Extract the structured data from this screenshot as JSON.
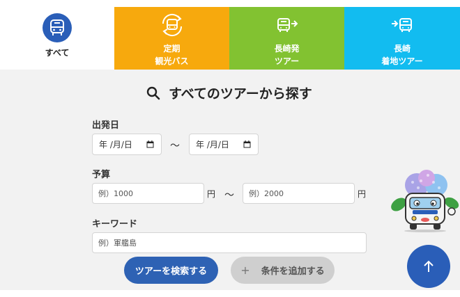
{
  "tabs": [
    {
      "label": "すべて",
      "icon": "bus-front-icon",
      "color": "#2a5eb8"
    },
    {
      "label_line1": "定期",
      "label_line2": "観光バス",
      "icon": "bus-loop-icon",
      "color": "#f7a90d"
    },
    {
      "label_line1": "長崎発",
      "label_line2": "ツアー",
      "icon": "bus-depart-icon",
      "color": "#82c231"
    },
    {
      "label_line1": "長崎",
      "label_line2": "着地ツアー",
      "icon": "bus-arrive-icon",
      "color": "#12bcf0"
    }
  ],
  "search": {
    "title": "すべてのツアーから探す",
    "departure": {
      "label": "出発日",
      "from_value": "年 /月/日",
      "to_value": "年 /月/日",
      "separator": "〜"
    },
    "budget": {
      "label": "予算",
      "min_placeholder": "例）1000",
      "max_placeholder": "例）2000",
      "unit": "円",
      "separator": "〜"
    },
    "keyword": {
      "label": "キーワード",
      "placeholder": "例）軍艦島"
    },
    "search_button": "ツアーを検索する",
    "add_condition_button": "条件を追加する",
    "add_condition_symbol": "+"
  },
  "colors": {
    "accent_blue": "#2a5eb8",
    "orange": "#f7a90d",
    "green": "#82c231",
    "cyan": "#12bcf0"
  }
}
